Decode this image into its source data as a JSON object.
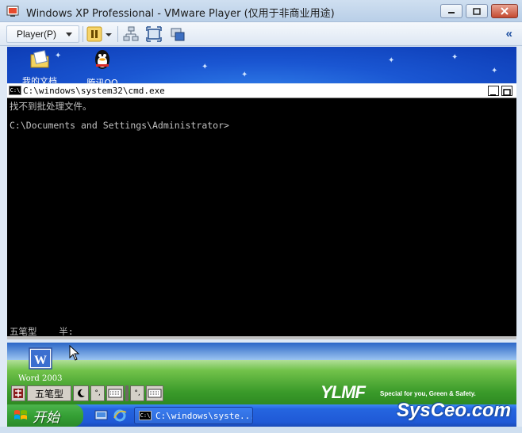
{
  "window": {
    "title": "Windows XP Professional - VMware Player (仅用于非商业用途)"
  },
  "toolbar": {
    "player_menu": "Player(P)",
    "collapse": "«"
  },
  "desktop": {
    "icons": [
      {
        "label": "我的文档",
        "icon": "my-documents-icon"
      },
      {
        "label": "腾讯QQ",
        "icon": "qq-icon"
      }
    ]
  },
  "cmd": {
    "title": "C:\\windows\\system32\\cmd.exe",
    "lines": [
      "找不到批处理文件。",
      "C:\\Documents and Settings\\Administrator>"
    ],
    "ime_status": "五笔型    半:"
  },
  "hills": {
    "word_label": "Word 2003",
    "ime_bar": {
      "mode": "五笔型",
      "punct_a": "°,",
      "punct_b": "°,"
    },
    "brand": "YLMF",
    "brand_tagline": "Special for you, Green & Safety."
  },
  "taskbar": {
    "start_label": "开始",
    "task_item": "C:\\windows\\syste..."
  },
  "watermark": "SysCeo.com",
  "colors": {
    "xp_taskbar": "#245edb",
    "start_green": "#35a035",
    "cmd_bg": "#000000",
    "cmd_fg": "#c0c0c0"
  }
}
